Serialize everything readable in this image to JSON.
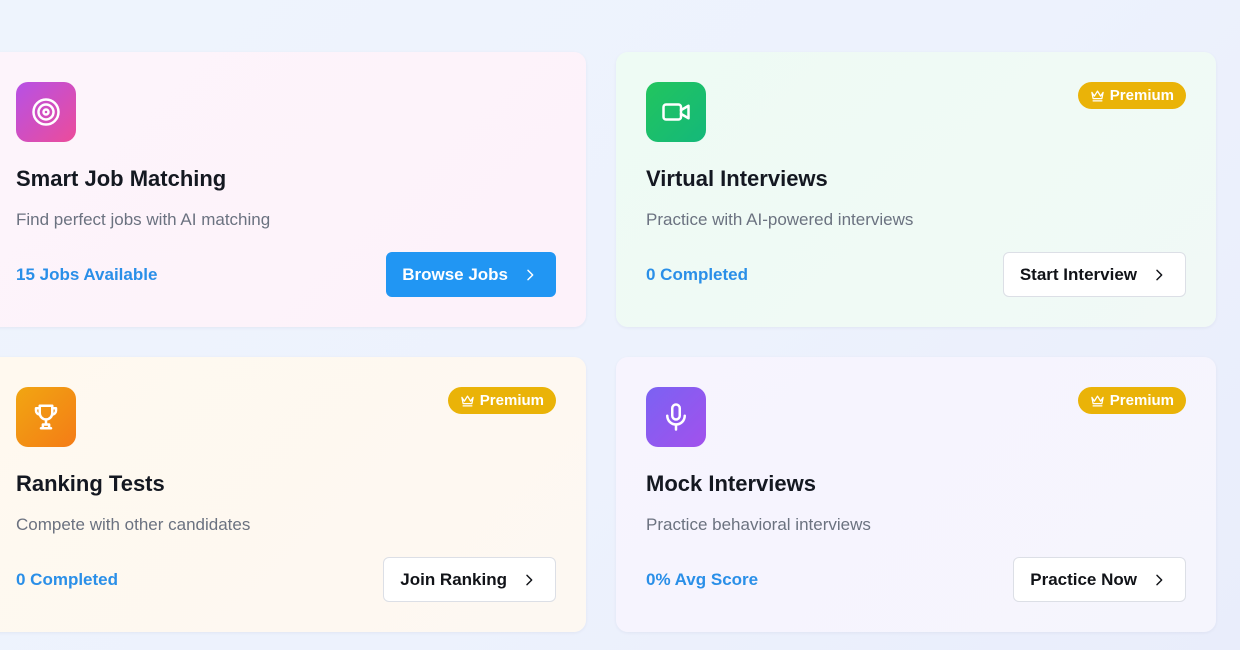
{
  "colors": {
    "primary_button": "#2196f3",
    "stat_text": "#2a8fe8",
    "premium_badge": "#eab308"
  },
  "cards": [
    {
      "title": "Smart Job Matching",
      "description": "Find perfect jobs with AI matching",
      "stat": "15 Jobs Available",
      "button_label": "Browse Jobs",
      "icon": "target-icon",
      "premium": false
    },
    {
      "title": "Virtual Interviews",
      "description": "Practice with AI-powered interviews",
      "stat": "0 Completed",
      "button_label": "Start Interview",
      "icon": "video-icon",
      "premium": true,
      "badge_label": "Premium"
    },
    {
      "title": "Ranking Tests",
      "description": "Compete with other candidates",
      "stat": "0 Completed",
      "button_label": "Join Ranking",
      "icon": "trophy-icon",
      "premium": true,
      "badge_label": "Premium"
    },
    {
      "title": "Mock Interviews",
      "description": "Practice behavioral interviews",
      "stat": "0% Avg Score",
      "button_label": "Practice Now",
      "icon": "microphone-icon",
      "premium": true,
      "badge_label": "Premium"
    }
  ]
}
